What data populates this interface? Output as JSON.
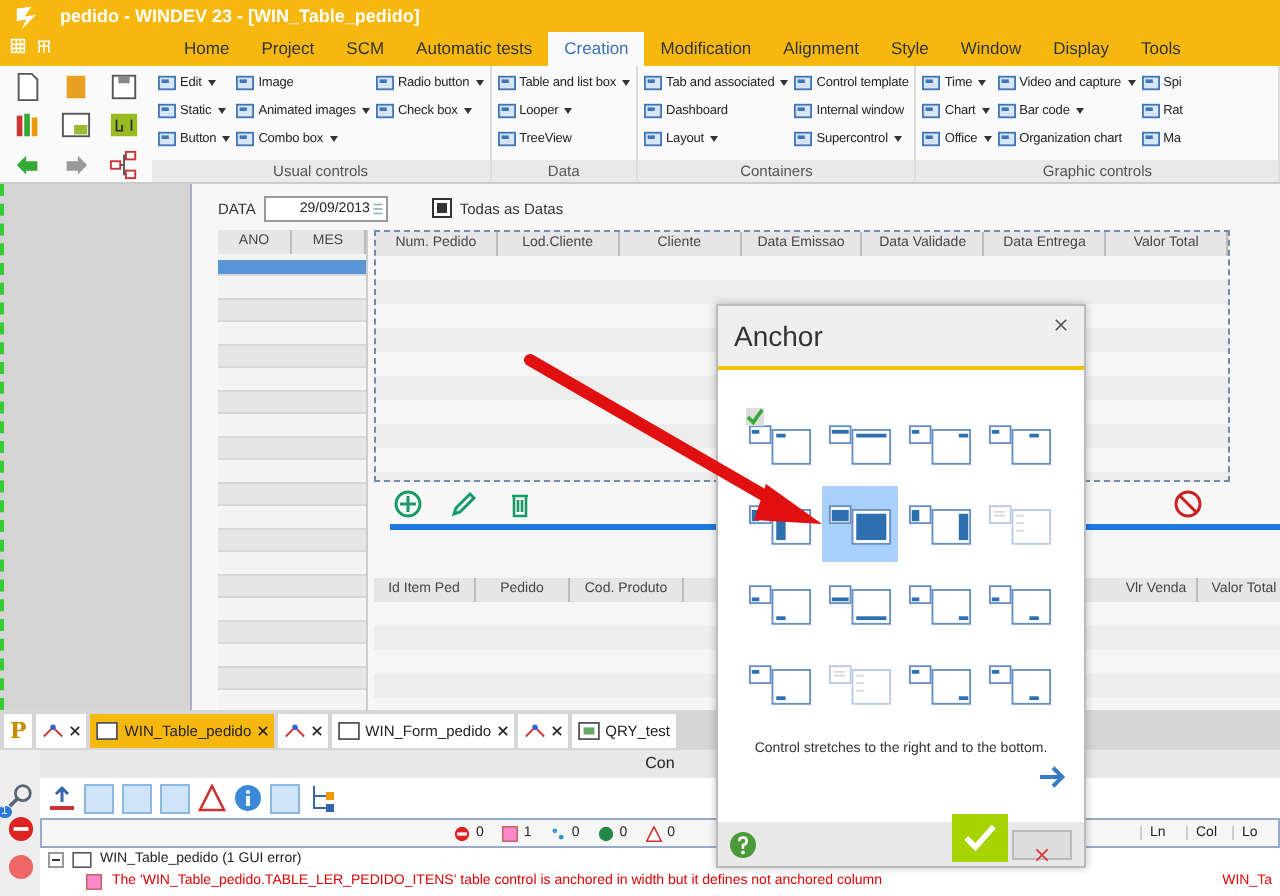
{
  "window": {
    "title": "pedido - WINDEV 23 - [WIN_Table_pedido]"
  },
  "menu_tabs": [
    {
      "label": "Home",
      "selected": false
    },
    {
      "label": "Project",
      "selected": false
    },
    {
      "label": "SCM",
      "selected": false
    },
    {
      "label": "Automatic tests",
      "selected": false
    },
    {
      "label": "Creation",
      "selected": true
    },
    {
      "label": "Modification",
      "selected": false
    },
    {
      "label": "Alignment",
      "selected": false
    },
    {
      "label": "Style",
      "selected": false
    },
    {
      "label": "Window",
      "selected": false
    },
    {
      "label": "Display",
      "selected": false
    },
    {
      "label": "Tools",
      "selected": false
    }
  ],
  "ribbon_groups": [
    {
      "title": "Usual controls",
      "columns": [
        [
          {
            "label": "Edit",
            "has_menu": true
          },
          {
            "label": "Static",
            "has_menu": true
          },
          {
            "label": "Button",
            "has_menu": true
          }
        ],
        [
          {
            "label": "Image",
            "has_menu": false
          },
          {
            "label": "Animated images",
            "has_menu": true
          },
          {
            "label": "Combo box",
            "has_menu": true
          }
        ],
        [
          {
            "label": "Radio button",
            "has_menu": true
          },
          {
            "label": "Check box",
            "has_menu": true
          }
        ]
      ]
    },
    {
      "title": "Data",
      "columns": [
        [
          {
            "label": "Table and list box",
            "has_menu": true
          },
          {
            "label": "Looper",
            "has_menu": true
          },
          {
            "label": "TreeView",
            "has_menu": false
          }
        ]
      ]
    },
    {
      "title": "Containers",
      "columns": [
        [
          {
            "label": "Tab and associated",
            "has_menu": true
          },
          {
            "label": "Dashboard",
            "has_menu": false
          },
          {
            "label": "Layout",
            "has_menu": true
          }
        ],
        [
          {
            "label": "Control template",
            "has_menu": false
          },
          {
            "label": "Internal window",
            "has_menu": false
          },
          {
            "label": "Supercontrol",
            "has_menu": true
          }
        ]
      ]
    },
    {
      "title": "Graphic controls",
      "columns": [
        [
          {
            "label": "Time",
            "has_menu": true
          },
          {
            "label": "Chart",
            "has_menu": true
          },
          {
            "label": "Office",
            "has_menu": true
          }
        ],
        [
          {
            "label": "Video and capture",
            "has_menu": true
          },
          {
            "label": "Bar code",
            "has_menu": true
          },
          {
            "label": "Organization chart",
            "has_menu": false
          }
        ],
        [
          {
            "label": "Spi"
          },
          {
            "label": "Rat"
          },
          {
            "label": "Ma"
          }
        ]
      ]
    }
  ],
  "form": {
    "date_label": "DATA",
    "date_value": "29/09/2013",
    "all_dates": {
      "label": "Todas as Datas",
      "checked": true
    }
  },
  "year_table": {
    "columns": [
      "ANO",
      "MES"
    ],
    "rows": [
      {
        "selected": true
      },
      {
        "selected": false
      },
      {
        "selected": false
      },
      {
        "selected": false
      },
      {
        "selected": false
      },
      {
        "selected": false
      },
      {
        "selected": false
      },
      {
        "selected": false
      },
      {
        "selected": false
      },
      {
        "selected": false
      },
      {
        "selected": false
      },
      {
        "selected": false
      },
      {
        "selected": false
      },
      {
        "selected": false
      },
      {
        "selected": false
      },
      {
        "selected": false
      },
      {
        "selected": false
      },
      {
        "selected": false
      },
      {
        "selected": false
      }
    ]
  },
  "orders_table": {
    "columns": [
      "Num. Pedido",
      "Lod.Cliente",
      "Cliente",
      "Data Emissao",
      "Data Validade",
      "Data Entrega",
      "Valor Total"
    ]
  },
  "items_table": {
    "columns": [
      "Id Item Ped",
      "Pedido",
      "Cod. Produto",
      "Vlr Venda",
      "Valor Total"
    ]
  },
  "anchor_dialog": {
    "title": "Anchor",
    "options": [
      {
        "selected": false,
        "checked": true,
        "disabled": false
      },
      {
        "selected": false,
        "checked": false,
        "disabled": false
      },
      {
        "selected": false,
        "checked": false,
        "disabled": false
      },
      {
        "selected": false,
        "checked": false,
        "disabled": false
      },
      {
        "selected": false,
        "checked": false,
        "disabled": false
      },
      {
        "selected": true,
        "checked": false,
        "disabled": false
      },
      {
        "selected": false,
        "checked": false,
        "disabled": false
      },
      {
        "selected": false,
        "checked": false,
        "disabled": true
      },
      {
        "selected": false,
        "checked": false,
        "disabled": false
      },
      {
        "selected": false,
        "checked": false,
        "disabled": false
      },
      {
        "selected": false,
        "checked": false,
        "disabled": false
      },
      {
        "selected": false,
        "checked": false,
        "disabled": false
      },
      {
        "selected": false,
        "checked": false,
        "disabled": false
      },
      {
        "selected": false,
        "checked": false,
        "disabled": true
      },
      {
        "selected": false,
        "checked": false,
        "disabled": false
      },
      {
        "selected": false,
        "checked": false,
        "disabled": false
      }
    ],
    "description": "Control stretches to the right and to the bottom."
  },
  "doc_tabs": [
    {
      "kind": "project",
      "label": "P",
      "selected": false
    },
    {
      "kind": "icon",
      "selected": false
    },
    {
      "kind": "window",
      "label": "WIN_Table_pedido",
      "selected": true
    },
    {
      "kind": "icon",
      "selected": false
    },
    {
      "kind": "window",
      "label": "WIN_Form_pedido",
      "selected": false
    },
    {
      "kind": "icon",
      "selected": false
    },
    {
      "kind": "query",
      "label": "QRY_test",
      "selected": false
    }
  ],
  "panel": {
    "title": "Con",
    "counters": [
      "0",
      "1",
      "0",
      "0",
      "0"
    ],
    "badge": "1",
    "columns": [
      "Ln",
      "Col",
      "Lo"
    ],
    "tree": {
      "label": "WIN_Table_pedido (1 GUI error)",
      "expanded": true,
      "children": [
        {
          "message": "The 'WIN_Table_pedido.TABLE_LER_PEDIDO_ITENS' table control is anchored in width but it defines not anchored column",
          "location": "WIN_Ta"
        }
      ]
    }
  }
}
